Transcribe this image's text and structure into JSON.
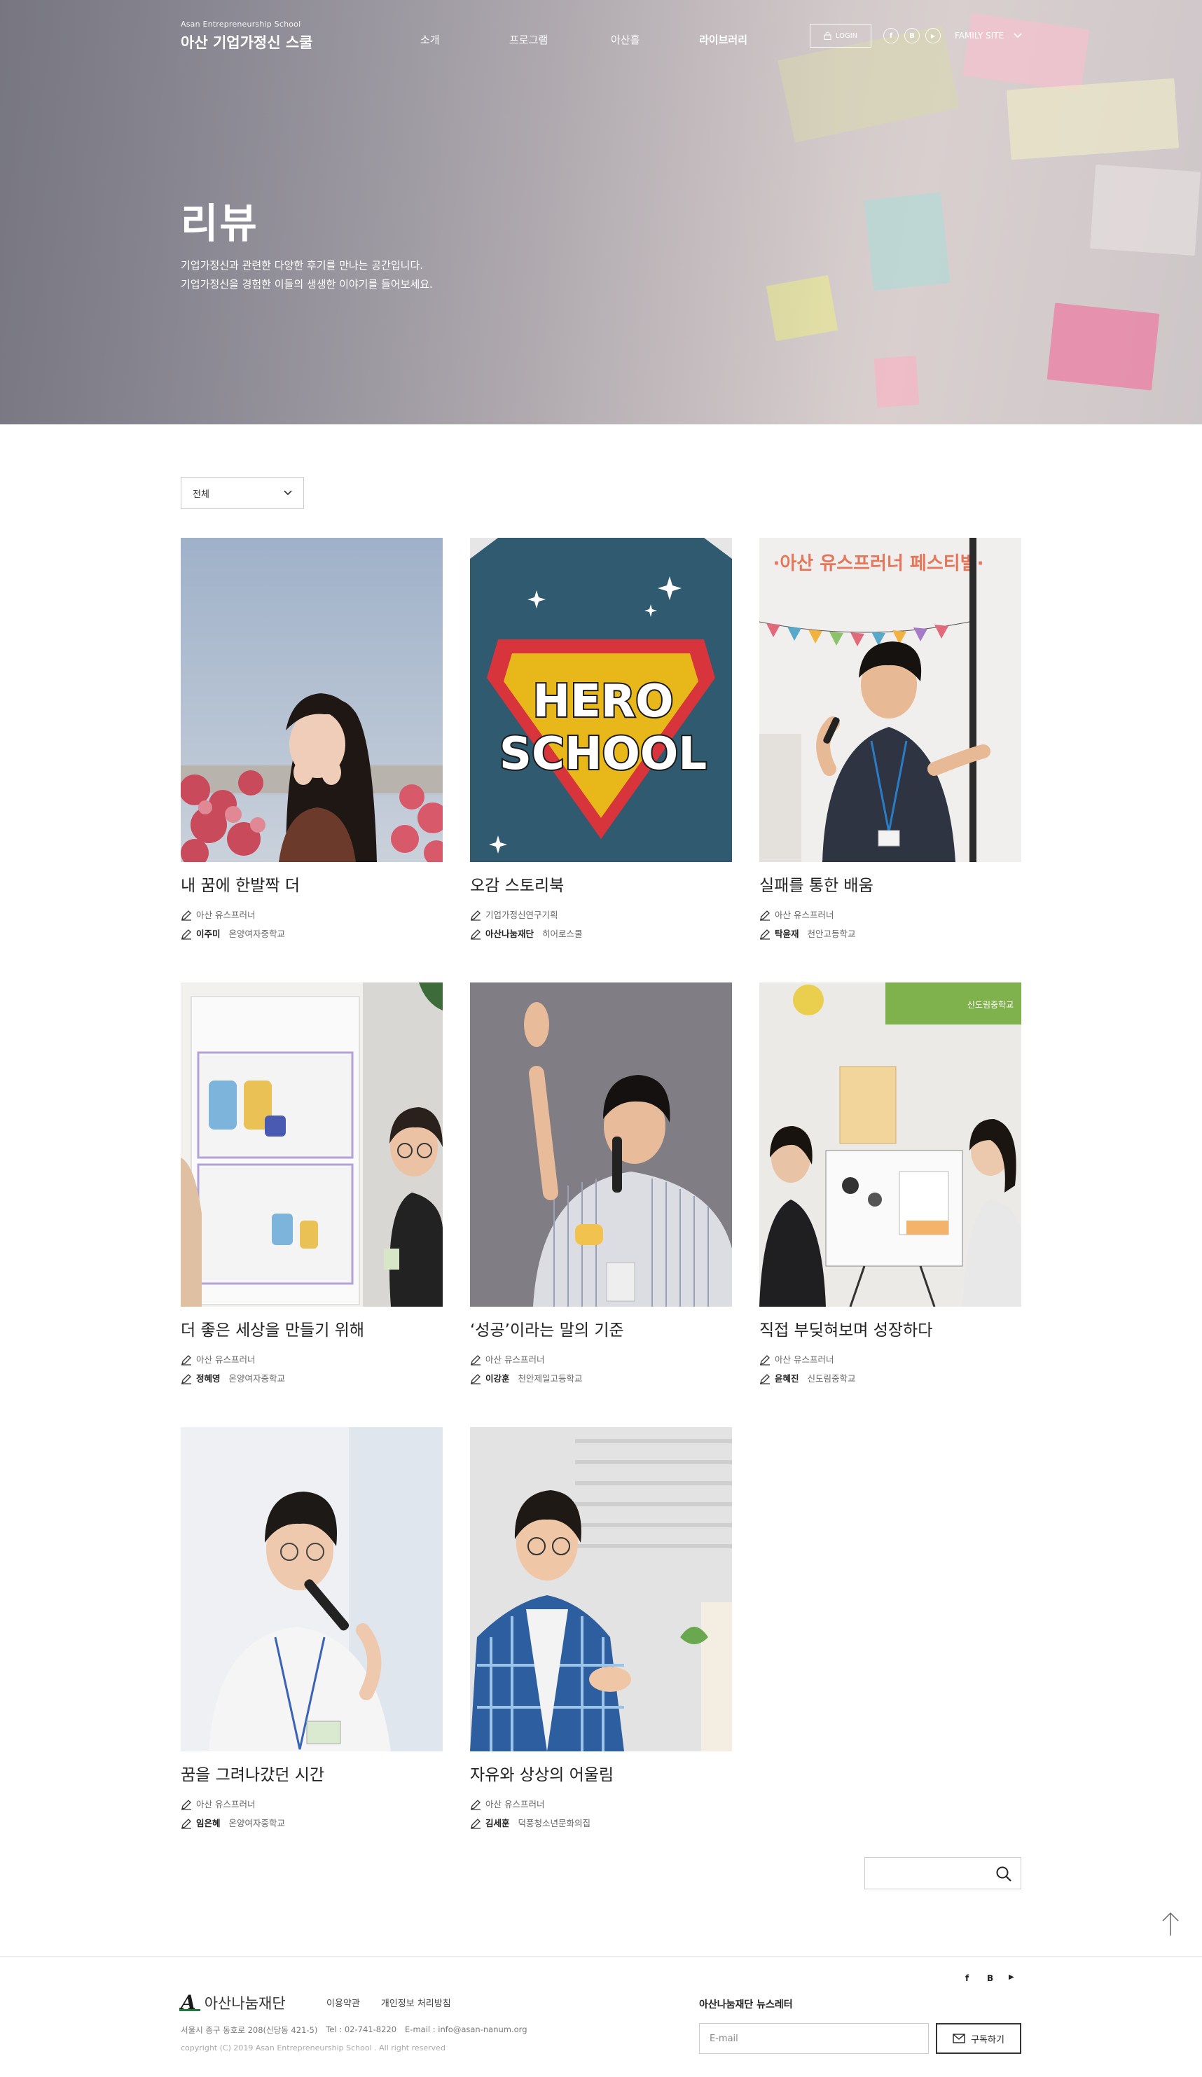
{
  "header": {
    "brand_eng": "Asan Entrepreneurship School",
    "brand_kor": "아산 기업가정신 스쿨",
    "nav": [
      "소개",
      "프로그램",
      "아산홀",
      "라이브러리"
    ],
    "login": "LOGIN",
    "social": [
      "f",
      "B",
      "▶"
    ],
    "family_site": "FAMILY SITE"
  },
  "hero": {
    "title": "리뷰",
    "desc_line1": "기업가정신과 관련한 다양한 후기를 만나는 공간입니다.",
    "desc_line2": "기업가정신을 경험한 이들의 생생한 이야기를 들어보세요."
  },
  "filter": {
    "selected": "전체"
  },
  "cards": [
    {
      "title": "내 꿈에 한발짝 더",
      "category": "아산 유스프러너",
      "author": "이주미",
      "org": "온양여자중학교"
    },
    {
      "title": "오감 스토리북",
      "category": "기업가정신연구기획",
      "author": "아산나눔재단",
      "org": "히어로스쿨"
    },
    {
      "title": "실패를 통한 배움",
      "category": "아산 유스프러너",
      "author": "탁윤재",
      "org": "천안고등학교"
    },
    {
      "title": "더 좋은 세상을 만들기 위해",
      "category": "아산 유스프러너",
      "author": "정혜영",
      "org": "온양여자중학교"
    },
    {
      "title": "‘성공’이라는 말의 기준",
      "category": "아산 유스프러너",
      "author": "이강훈",
      "org": "천안제일고등학교"
    },
    {
      "title": "직접 부딪혀보며 성장하다",
      "category": "아산 유스프러너",
      "author": "윤혜진",
      "org": "신도림중학교"
    },
    {
      "title": "꿈을 그려나갔던 시간",
      "category": "아산 유스프러너",
      "author": "임은혜",
      "org": "온양여자중학교"
    },
    {
      "title": "자유와 상상의 어울림",
      "category": "아산 유스프러너",
      "author": "김세훈",
      "org": "덕풍청소년문화의집"
    }
  ],
  "hero_school": {
    "line1": "HERO",
    "line2": "SCHOOL"
  },
  "festival_banner": "·아산 유스프러너 페스티벌·",
  "school_sign": "신도림중학교",
  "search": {
    "placeholder": ""
  },
  "footer": {
    "logo_mark": "A",
    "logo_name": "아산나눔재단",
    "links": [
      "이용약관",
      "개인정보 처리방침"
    ],
    "address": "서울시 종구 동호로 208(신당동 421-5)",
    "tel": "Tel : 02-741-8220",
    "email": "E-mail : info@asan-nanum.org",
    "copyright": "copyright (C) 2019 Asan Entrepreneurship School . All right reserved",
    "social": [
      "f",
      "B",
      "▶"
    ],
    "newsletter_title": "아산나눔재단 뉴스레터",
    "newsletter_placeholder": "E-mail",
    "subscribe": "구독하기"
  },
  "colors": {
    "accent_green": "#1d7a3a",
    "hero_school_bg": "#2f5a6f",
    "hero_school_red": "#d8343b",
    "hero_school_yellow": "#e8b719"
  }
}
